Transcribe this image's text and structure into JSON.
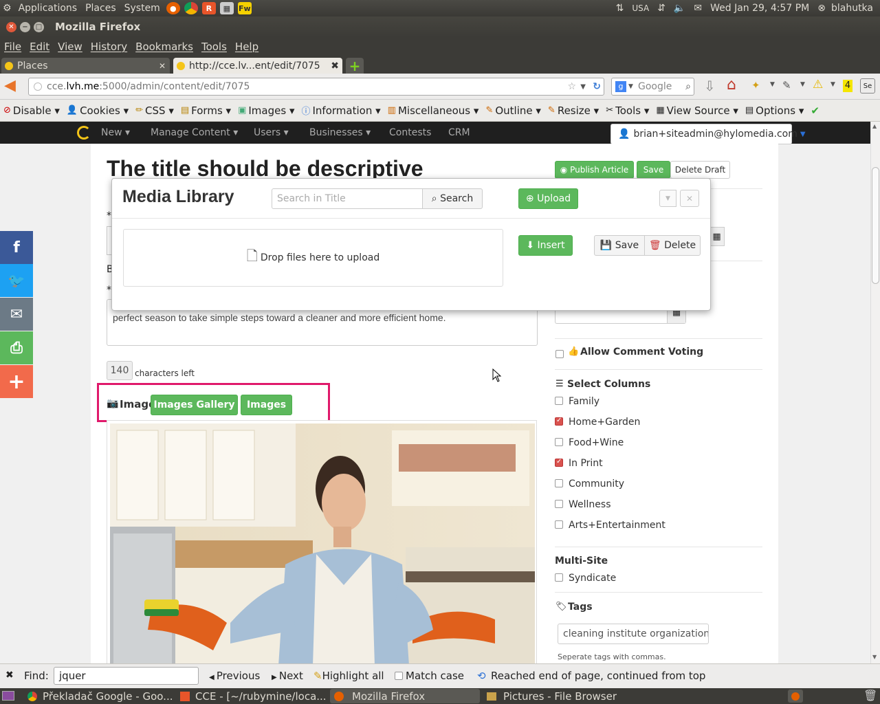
{
  "top_panel": {
    "menus": [
      "Applications",
      "Places",
      "System"
    ],
    "launchers": [
      "firefox-icon",
      "chrome-icon",
      "rubymine-icon",
      "calculator-icon",
      "fireworks-icon"
    ],
    "launcher_fw": "Fw",
    "keyboard": "USA",
    "datetime": "Wed Jan 29,  4:57 PM",
    "user": "blahutka"
  },
  "window": {
    "title": "Mozilla Firefox"
  },
  "menubar": [
    "File",
    "Edit",
    "View",
    "History",
    "Bookmarks",
    "Tools",
    "Help"
  ],
  "tabs": [
    {
      "label": "Places"
    },
    {
      "label": "http://cce.lv...ent/edit/7075"
    }
  ],
  "navbar": {
    "url_prefix": "cce.",
    "url_domain": "lvh.me",
    "url_rest": ":5000/admin/content/edit/7075",
    "search_placeholder": "Google",
    "badge": "4"
  },
  "devbar": [
    "Disable",
    "Cookies",
    "CSS",
    "Forms",
    "Images",
    "Information",
    "Miscellaneous",
    "Outline",
    "Resize",
    "Tools",
    "View Source",
    "Options"
  ],
  "site_nav": {
    "items": [
      "New",
      "Manage Content",
      "Users",
      "Businesses",
      "Contests",
      "CRM"
    ],
    "user": "brian+siteadmin@hylomedia.com"
  },
  "article": {
    "title": "The title should be descriptive",
    "publish": "Publish Article",
    "save": "Save",
    "delete_draft": "Delete Draft",
    "label_b": "B",
    "star": "*",
    "summary": "Shorter days and cooler nights mean more time spent indoors. For many Americans, this is the perfect season to take simple steps toward a cleaner and more efficient home.",
    "chars_count": "140",
    "chars_label": "characters left",
    "image_label": "Image",
    "images_gallery": "Images Gallery",
    "images": "Images"
  },
  "modal": {
    "title": "Media Library",
    "search_placeholder": "Search in Title",
    "search_btn": "Search",
    "upload_btn": "Upload",
    "drop_text": "Drop files here to upload",
    "insert_btn": "Insert",
    "save_btn": "Save",
    "delete_btn": "Delete"
  },
  "sidebar": {
    "allow_voting": "Allow Comment Voting",
    "select_columns": "Select Columns",
    "columns": [
      {
        "label": "Family",
        "checked": false
      },
      {
        "label": "Home+Garden",
        "checked": true
      },
      {
        "label": "Food+Wine",
        "checked": false
      },
      {
        "label": "In Print",
        "checked": true
      },
      {
        "label": "Community",
        "checked": false
      },
      {
        "label": "Wellness",
        "checked": false
      },
      {
        "label": "Arts+Entertainment",
        "checked": false
      }
    ],
    "multisite": "Multi-Site",
    "syndicate": "Syndicate",
    "tags_title": "Tags",
    "tags_value": "cleaning institute organization, h",
    "tags_hint": "Seperate tags with commas."
  },
  "findbar": {
    "label": "Find:",
    "value": "jquer",
    "previous": "Previous",
    "next": "Next",
    "highlight": "Highlight all",
    "match_case": "Match case",
    "status": "Reached end of page, continued from top"
  },
  "taskbar": [
    "Překladač Google - Goo...",
    "CCE - [~/rubymine/loca...",
    "Mozilla Firefox",
    "Pictures - File Browser"
  ],
  "colors": {
    "accent_green": "#5cb85c",
    "highlight_border": "#e0196b",
    "facebook": "#3b5998",
    "twitter": "#1da1f2",
    "email": "#6c7a86",
    "print": "#5cb85c",
    "share": "#f26a4b"
  }
}
